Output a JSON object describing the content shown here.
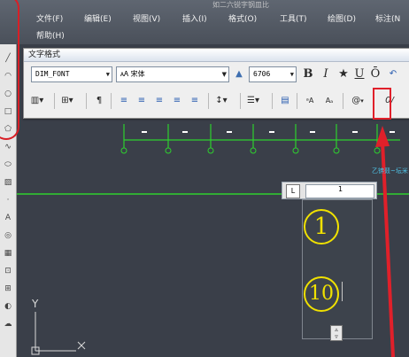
{
  "menubar": {
    "items": [
      "文件(F)",
      "编辑(E)",
      "视图(V)",
      "插入(I)",
      "格式(O)",
      "工具(T)",
      "绘图(D)",
      "标注(N"
    ],
    "second_row": [
      "帮助(H)"
    ],
    "title_fragment": "如二六锐字钢皿比"
  },
  "text_format": {
    "title": "文字格式",
    "style_combo": "DIM_FONT",
    "font_combo": "宋体",
    "font_prefix": "宋",
    "height_combo": "6706",
    "bold": "B",
    "italic": "I",
    "underline": "U",
    "overline": "Ō",
    "undo": "↶",
    "symbol_button": "@",
    "oblique_value": "0/"
  },
  "drawing": {
    "cyan_label": "乙锛叕~坛米",
    "editor_ruler_value": "1",
    "ruler_corner": "L",
    "circled_numbers": [
      "1",
      "10"
    ],
    "ucs_y": "Y",
    "ucs_x": "X",
    "colors": {
      "canvas": "#3a3f49",
      "green": "#2ed02e",
      "yellow": "#f0e100",
      "red": "#e0202a"
    }
  }
}
